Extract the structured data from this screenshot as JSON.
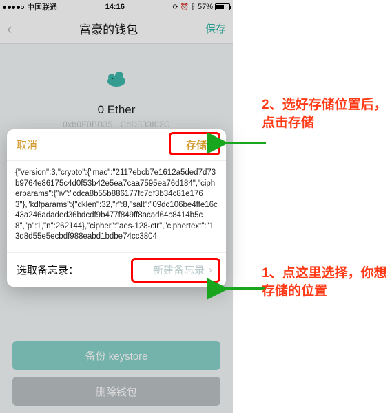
{
  "status": {
    "carrier": "中国联通",
    "time": "14:16",
    "battery_pct": "57%",
    "signal_dots_filled": 4,
    "signal_dots_total": 5
  },
  "nav": {
    "title": "富豪的钱包",
    "save_label": "保存"
  },
  "wallet": {
    "balance": "0 Ether",
    "address": "0xb0F0BB35...CdD333f02C"
  },
  "modal": {
    "cancel_label": "取消",
    "store_label": "存储",
    "blob": "{\"version\":3,\"crypto\":{\"mac\":\"2117ebcb7e1612a5ded7d73b9764e86175c4d0f53b42e5ea7caa7595ea76d184\",\"cipherparams\":{\"iv\":\"cdca8b55b886177fc7df3b34c81e1763\"},\"kdfparams\":{\"dklen\":32,\"r\":8,\"salt\":\"09dc106be4ffe16c43a246adaded36bdcdf9b477f849ff8acad64c8414b5c8\",\"p\":1,\"n\":262144},\"cipher\":\"aes-128-ctr\",\"ciphertext\":\"13d8d55e5ecbdf988eabd1bdbe74cc3804",
    "memo_label": "选取备忘录：",
    "memo_action": "新建备忘录"
  },
  "buttons": {
    "backup": "备份 keystore",
    "delete": "删除钱包"
  },
  "annotations": {
    "a2": "2、选好存储位置后，点击存储",
    "a1": "1、点这里选择，你想存储的位置"
  },
  "icons": {
    "alarm": "⏰",
    "bt": "ᛒ"
  }
}
